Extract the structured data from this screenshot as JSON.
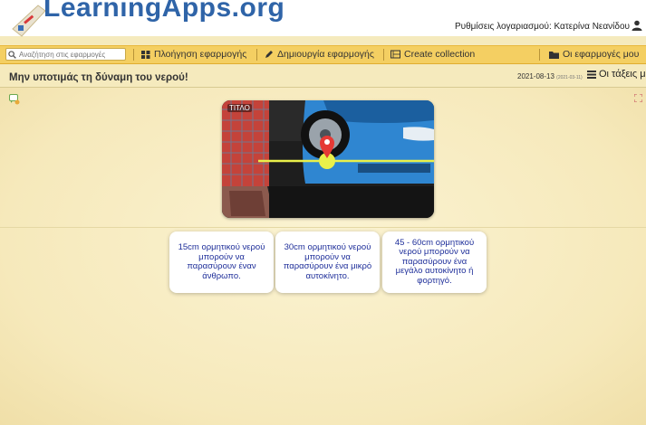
{
  "header": {
    "logo_text": "LearningApps.org",
    "account_text": "Ρυθμίσεις λογαριασμού: Κατερίνα Νεανίδου"
  },
  "nav": {
    "search_placeholder": "Αναζήτηση στις εφαρμογές",
    "browse_label": "Πλοήγηση εφαρμογής",
    "create_app_label": "Δημιουργία εφαρμογής",
    "create_collection_label": "Create collection",
    "my_apps_label": "Οι εφαρμογές μου"
  },
  "app": {
    "title": "Μην υποτιμάς τη δύναμη του νερού!",
    "date": "2021-08-13",
    "date_small": "(2021-03-11)",
    "my_classes_label": "Οι τάξεις μο"
  },
  "picture": {
    "label": "ΤΙΤΛΟ"
  },
  "cards": [
    {
      "text": "15cm ορμητικού νερού μπορούν να παρασύρουν έναν άνθρωπο."
    },
    {
      "text": "30cm ορμητικού νερού μπορούν να παρασύρουν ένα μικρό αυτοκίνητο."
    },
    {
      "text": "45 - 60cm ορμητικού νερού μπορούν να παρασύρουν ένα μεγάλο αυτοκίνητο ή φορτηγό."
    }
  ],
  "colors": {
    "nav_bg": "#f4cf62",
    "board_bg": "#f5eabd",
    "card_text": "#1f2f9a",
    "logo": "#2f64a8"
  }
}
